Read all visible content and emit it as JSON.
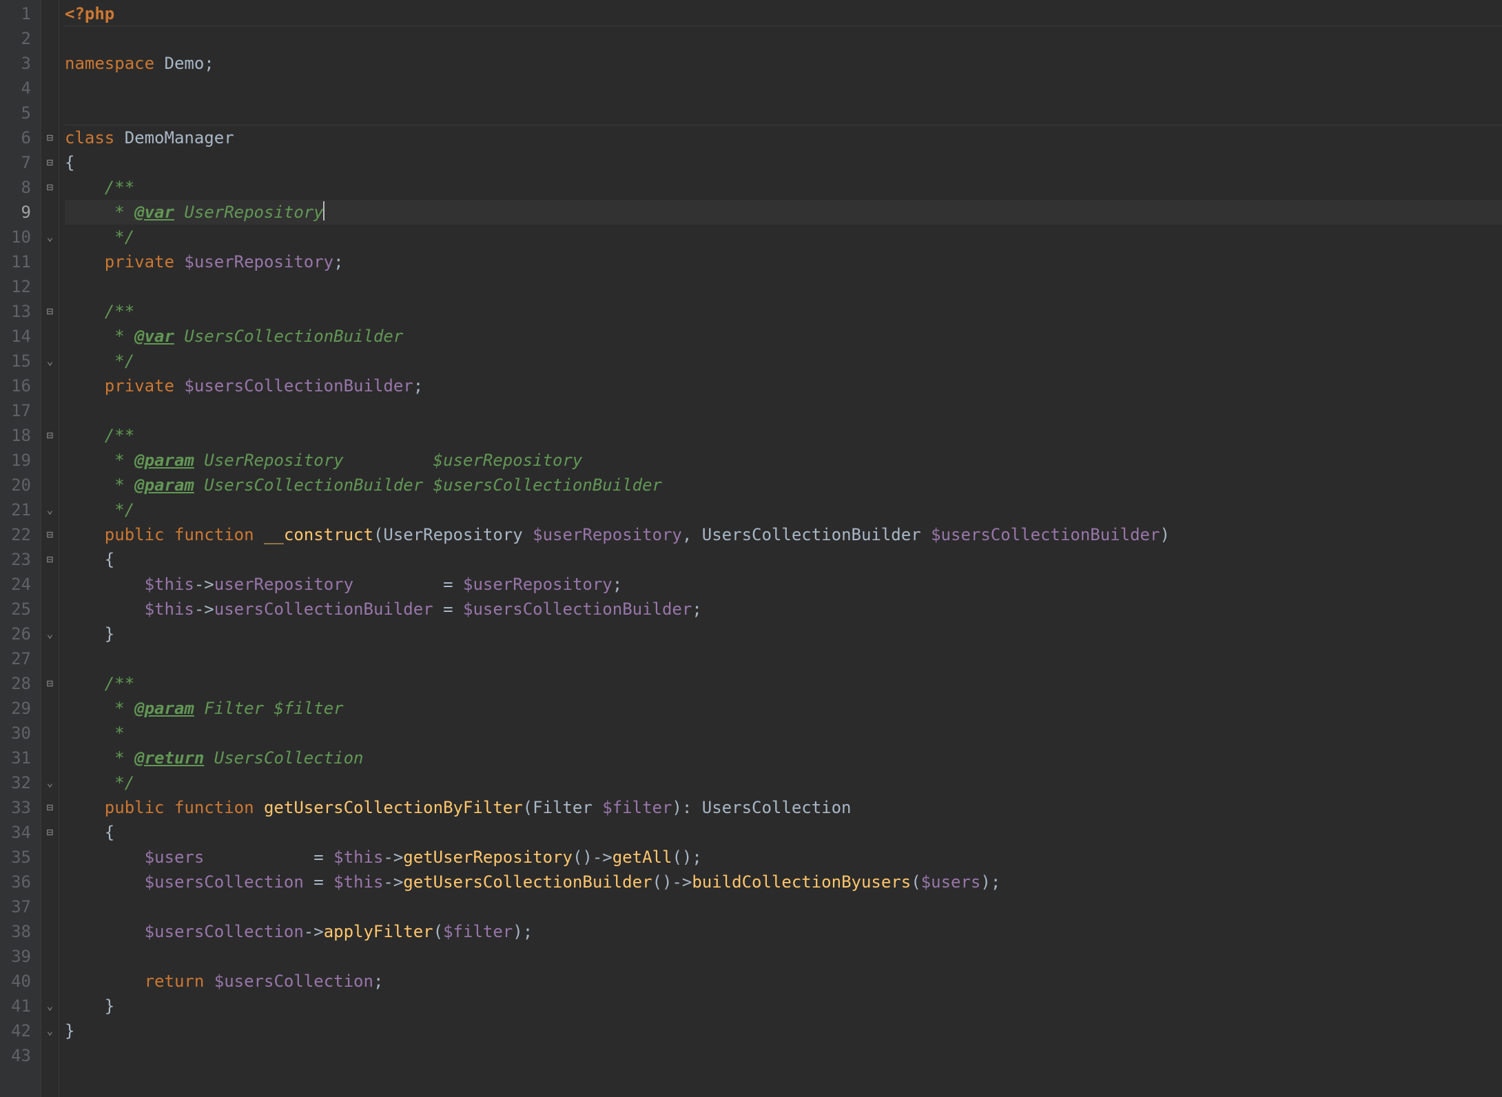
{
  "current_line": 9,
  "gutter": {
    "start": 1,
    "end": 43
  },
  "fold_markers": {
    "6": "open",
    "7": "open",
    "8": "open",
    "10": "close",
    "13": "open",
    "15": "close",
    "18": "open",
    "21": "close",
    "22": "open",
    "23": "open",
    "26": "close",
    "28": "open",
    "32": "close",
    "33": "open",
    "34": "open",
    "41": "close",
    "42": "close"
  },
  "lines": {
    "l1": [
      {
        "t": "<?php",
        "c": "tok-proc"
      }
    ],
    "l2": [
      {
        "t": "",
        "c": ""
      }
    ],
    "l3": [
      {
        "t": "namespace ",
        "c": "tok-keyword"
      },
      {
        "t": "Demo;",
        "c": "tok-default"
      }
    ],
    "l4": [
      {
        "t": "",
        "c": ""
      }
    ],
    "l5": [
      {
        "t": "",
        "c": ""
      }
    ],
    "l6": [
      {
        "t": "class ",
        "c": "tok-keyword"
      },
      {
        "t": "DemoManager",
        "c": "tok-class"
      }
    ],
    "l7": [
      {
        "t": "{",
        "c": "tok-default"
      }
    ],
    "l8": [
      {
        "t": "    /**",
        "c": "tok-doc"
      }
    ],
    "l9": [
      {
        "t": "     * ",
        "c": "tok-doc"
      },
      {
        "t": "@var",
        "c": "tok-doctag"
      },
      {
        "t": " UserRepository",
        "c": "tok-doc"
      },
      {
        "t": "",
        "c": "caret"
      }
    ],
    "l10": [
      {
        "t": "     */",
        "c": "tok-doc"
      }
    ],
    "l11": [
      {
        "t": "    ",
        "c": ""
      },
      {
        "t": "private ",
        "c": "tok-keyword"
      },
      {
        "t": "$userRepository",
        "c": "tok-var"
      },
      {
        "t": ";",
        "c": "tok-default"
      }
    ],
    "l12": [
      {
        "t": "",
        "c": ""
      }
    ],
    "l13": [
      {
        "t": "    /**",
        "c": "tok-doc"
      }
    ],
    "l14": [
      {
        "t": "     * ",
        "c": "tok-doc"
      },
      {
        "t": "@var",
        "c": "tok-doctag"
      },
      {
        "t": " UsersCollectionBuilder",
        "c": "tok-doc"
      }
    ],
    "l15": [
      {
        "t": "     */",
        "c": "tok-doc"
      }
    ],
    "l16": [
      {
        "t": "    ",
        "c": ""
      },
      {
        "t": "private ",
        "c": "tok-keyword"
      },
      {
        "t": "$usersCollectionBuilder",
        "c": "tok-var"
      },
      {
        "t": ";",
        "c": "tok-default"
      }
    ],
    "l17": [
      {
        "t": "",
        "c": ""
      }
    ],
    "l18": [
      {
        "t": "    /**",
        "c": "tok-doc"
      }
    ],
    "l19": [
      {
        "t": "     * ",
        "c": "tok-doc"
      },
      {
        "t": "@param",
        "c": "tok-doctag"
      },
      {
        "t": " UserRepository         $userRepository",
        "c": "tok-doc"
      }
    ],
    "l20": [
      {
        "t": "     * ",
        "c": "tok-doc"
      },
      {
        "t": "@param",
        "c": "tok-doctag"
      },
      {
        "t": " UsersCollectionBuilder $usersCollectionBuilder",
        "c": "tok-doc"
      }
    ],
    "l21": [
      {
        "t": "     */",
        "c": "tok-doc"
      }
    ],
    "l22": [
      {
        "t": "    ",
        "c": ""
      },
      {
        "t": "public function ",
        "c": "tok-keyword"
      },
      {
        "t": "__construct",
        "c": "tok-magic"
      },
      {
        "t": "(UserRepository ",
        "c": "tok-default"
      },
      {
        "t": "$userRepository",
        "c": "tok-var"
      },
      {
        "t": ", UsersCollectionBuilder ",
        "c": "tok-default"
      },
      {
        "t": "$usersCollectionBuilder",
        "c": "tok-var"
      },
      {
        "t": ")",
        "c": "tok-default"
      }
    ],
    "l23": [
      {
        "t": "    {",
        "c": "tok-default"
      }
    ],
    "l24": [
      {
        "t": "        ",
        "c": ""
      },
      {
        "t": "$this",
        "c": "tok-var"
      },
      {
        "t": "->",
        "c": "tok-default"
      },
      {
        "t": "userRepository",
        "c": "tok-var"
      },
      {
        "t": "         = ",
        "c": "tok-default"
      },
      {
        "t": "$userRepository",
        "c": "tok-var"
      },
      {
        "t": ";",
        "c": "tok-default"
      }
    ],
    "l25": [
      {
        "t": "        ",
        "c": ""
      },
      {
        "t": "$this",
        "c": "tok-var"
      },
      {
        "t": "->",
        "c": "tok-default"
      },
      {
        "t": "usersCollectionBuilder",
        "c": "tok-var"
      },
      {
        "t": " = ",
        "c": "tok-default"
      },
      {
        "t": "$usersCollectionBuilder",
        "c": "tok-var"
      },
      {
        "t": ";",
        "c": "tok-default"
      }
    ],
    "l26": [
      {
        "t": "    }",
        "c": "tok-default"
      }
    ],
    "l27": [
      {
        "t": "",
        "c": ""
      }
    ],
    "l28": [
      {
        "t": "    /**",
        "c": "tok-doc"
      }
    ],
    "l29": [
      {
        "t": "     * ",
        "c": "tok-doc"
      },
      {
        "t": "@param",
        "c": "tok-doctag"
      },
      {
        "t": " Filter $filter",
        "c": "tok-doc"
      }
    ],
    "l30": [
      {
        "t": "     *",
        "c": "tok-doc"
      }
    ],
    "l31": [
      {
        "t": "     * ",
        "c": "tok-doc"
      },
      {
        "t": "@return",
        "c": "tok-doctag"
      },
      {
        "t": " UsersCollection",
        "c": "tok-doc"
      }
    ],
    "l32": [
      {
        "t": "     */",
        "c": "tok-doc"
      }
    ],
    "l33": [
      {
        "t": "    ",
        "c": ""
      },
      {
        "t": "public function ",
        "c": "tok-keyword"
      },
      {
        "t": "getUsersCollectionByFilter",
        "c": "tok-func-def"
      },
      {
        "t": "(Filter ",
        "c": "tok-default"
      },
      {
        "t": "$filter",
        "c": "tok-var"
      },
      {
        "t": "): UsersCollection",
        "c": "tok-default"
      }
    ],
    "l34": [
      {
        "t": "    {",
        "c": "tok-default"
      }
    ],
    "l35": [
      {
        "t": "        ",
        "c": ""
      },
      {
        "t": "$users",
        "c": "tok-var"
      },
      {
        "t": "           = ",
        "c": "tok-default"
      },
      {
        "t": "$this",
        "c": "tok-var"
      },
      {
        "t": "->",
        "c": "tok-default"
      },
      {
        "t": "getUserRepository",
        "c": "tok-func"
      },
      {
        "t": "()->",
        "c": "tok-default"
      },
      {
        "t": "getAll",
        "c": "tok-func"
      },
      {
        "t": "();",
        "c": "tok-default"
      }
    ],
    "l36": [
      {
        "t": "        ",
        "c": ""
      },
      {
        "t": "$usersCollection",
        "c": "tok-var"
      },
      {
        "t": " = ",
        "c": "tok-default"
      },
      {
        "t": "$this",
        "c": "tok-var"
      },
      {
        "t": "->",
        "c": "tok-default"
      },
      {
        "t": "getUsersCollectionBuilder",
        "c": "tok-func"
      },
      {
        "t": "()->",
        "c": "tok-default"
      },
      {
        "t": "buildCollectionByusers",
        "c": "tok-func"
      },
      {
        "t": "(",
        "c": "tok-default"
      },
      {
        "t": "$users",
        "c": "tok-var"
      },
      {
        "t": ");",
        "c": "tok-default"
      }
    ],
    "l37": [
      {
        "t": "",
        "c": ""
      }
    ],
    "l38": [
      {
        "t": "        ",
        "c": ""
      },
      {
        "t": "$usersCollection",
        "c": "tok-var"
      },
      {
        "t": "->",
        "c": "tok-default"
      },
      {
        "t": "applyFilter",
        "c": "tok-func"
      },
      {
        "t": "(",
        "c": "tok-default"
      },
      {
        "t": "$filter",
        "c": "tok-var"
      },
      {
        "t": ");",
        "c": "tok-default"
      }
    ],
    "l39": [
      {
        "t": "",
        "c": ""
      }
    ],
    "l40": [
      {
        "t": "        ",
        "c": ""
      },
      {
        "t": "return ",
        "c": "tok-keyword"
      },
      {
        "t": "$usersCollection",
        "c": "tok-var"
      },
      {
        "t": ";",
        "c": "tok-default"
      }
    ],
    "l41": [
      {
        "t": "    }",
        "c": "tok-default"
      }
    ],
    "l42": [
      {
        "t": "}",
        "c": "tok-default"
      }
    ],
    "l43": [
      {
        "t": "",
        "c": ""
      }
    ]
  },
  "hr_after": [
    1,
    5
  ],
  "glyphs": {
    "open": "⊟",
    "close": "⌄"
  }
}
